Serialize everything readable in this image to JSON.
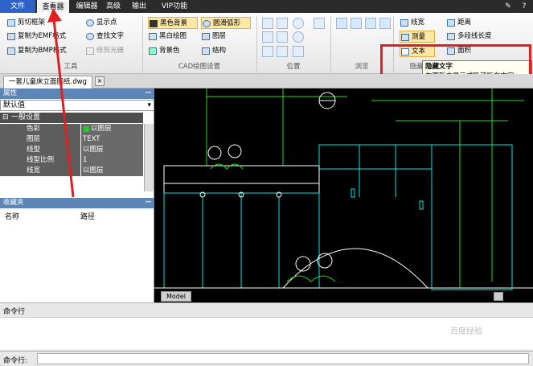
{
  "menubar": {
    "items": [
      "文件",
      "查看器",
      "编辑器",
      "高级",
      "输出",
      "VIP功能"
    ],
    "active": "查看器",
    "colors": {
      "file_tab": "#2d63c8",
      "active_border": "#ffffff"
    }
  },
  "ribbon": {
    "tools": {
      "buttons": [
        "剪切框架",
        "复制为EMF格式",
        "复制为BMP格式",
        "显示点",
        "查找文字",
        "修剪光栅"
      ],
      "group_label": "工具"
    },
    "cad_settings": {
      "buttons": [
        "黑色背景",
        "黑白绘图",
        "背景色",
        "圆滑弧形",
        "图层",
        "结构"
      ],
      "group_label": "CAD绘图设置"
    },
    "position": {
      "group_label": "位置"
    },
    "browse": {
      "group_label": "浏览"
    },
    "hide": {
      "buttons": [
        "线宽",
        "测量",
        "文本",
        "距离",
        "多段线长度",
        "面积"
      ],
      "group_label": "隐藏"
    }
  },
  "tooltip": {
    "title": "隐藏文字",
    "body": "在图形中显示或隐藏所有文字"
  },
  "document": {
    "tab_label": "一套儿童床立面图纸.dwg",
    "close_symbol": "×"
  },
  "properties": {
    "header": "属性",
    "pin": "ꟷ",
    "dropdown_value": "默认值",
    "section": "一般设置",
    "rows": [
      {
        "key": "色彩",
        "value": "以图层"
      },
      {
        "key": "图层",
        "value": "TEXT"
      },
      {
        "key": "线型",
        "value": "以图层"
      },
      {
        "key": "线型比例",
        "value": "1"
      },
      {
        "key": "线宽",
        "value": "以图层"
      }
    ]
  },
  "favorites": {
    "header": "收藏夹",
    "columns": [
      "名称",
      "路径"
    ]
  },
  "canvas": {
    "model_tab": "Model",
    "bg": "#000000"
  },
  "command": {
    "header": "命令行",
    "prompt_label": "命令行:"
  },
  "watermark": "百度经验"
}
